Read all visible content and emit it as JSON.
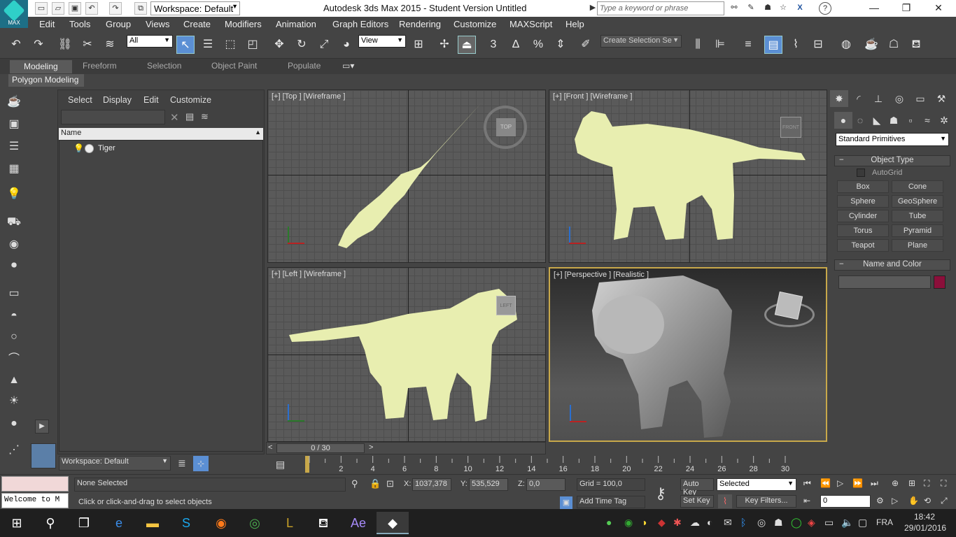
{
  "app": {
    "title": "Autodesk 3ds Max  2015  - Student Version   Untitled",
    "logo_text": "MAX",
    "workspace_dropdown": "Workspace: Default",
    "search_placeholder": "Type a keyword or phrase"
  },
  "menubar": [
    "Edit",
    "Tools",
    "Group",
    "Views",
    "Create",
    "Modifiers",
    "Animation",
    "Graph Editors",
    "Rendering",
    "Customize",
    "MAXScript",
    "Help"
  ],
  "toolbar": {
    "selection_filter": "All",
    "ref_coord": "View",
    "named_selection_placeholder": "Create Selection Se",
    "snap_label": "3",
    "angle_snap_label": "∆",
    "percent_snap_label": "%"
  },
  "ribbon": {
    "tabs": [
      "Modeling",
      "Freeform",
      "Selection",
      "Object Paint",
      "Populate"
    ],
    "panel": "Polygon Modeling"
  },
  "scene_explorer": {
    "menu": [
      "Select",
      "Display",
      "Edit",
      "Customize"
    ],
    "column_header": "Name",
    "items": [
      {
        "name": "Tiger"
      }
    ],
    "workspace": "Workspace: Default"
  },
  "viewports": {
    "top": "[+] [Top ] [Wireframe ]",
    "front": "[+] [Front ] [Wireframe ]",
    "left": "[+] [Left ] [Wireframe ]",
    "perspective": "[+] [Perspective ] [Realistic ]",
    "viewcube_top": "TOP",
    "viewcube_front": "FRONT",
    "viewcube_left": "LEFT"
  },
  "command_panel": {
    "category": "Standard Primitives",
    "object_type_title": "Object Type",
    "autogrid": "AutoGrid",
    "buttons": [
      "Box",
      "Cone",
      "Sphere",
      "GeoSphere",
      "Cylinder",
      "Tube",
      "Torus",
      "Pyramid",
      "Teapot",
      "Plane"
    ],
    "name_color_title": "Name and Color",
    "color": "#8b0f3a"
  },
  "timeline": {
    "frame": "0 / 30",
    "ticks": [
      "0",
      "2",
      "4",
      "6",
      "8",
      "10",
      "12",
      "14",
      "16",
      "18",
      "20",
      "22",
      "24",
      "26",
      "28",
      "30"
    ]
  },
  "status": {
    "selection": "None Selected",
    "prompt": "Click or click-and-drag to select objects",
    "maxscript": "Welcome to M",
    "x_label": "X:",
    "x": "1037,378",
    "y_label": "Y:",
    "y": "535,529",
    "z_label": "Z:",
    "z": "0,0",
    "grid": "Grid = 100,0",
    "add_time_tag": "Add Time Tag",
    "auto_key": "Auto Key",
    "set_key": "Set Key",
    "key_mode": "Selected",
    "key_filters": "Key Filters...",
    "current_frame": "0"
  },
  "taskbar": {
    "lang": "FRA",
    "time": "18:42",
    "date": "29/01/2016"
  },
  "colors": {
    "wire": "#e8eeb0",
    "accent": "#5b8fd4"
  }
}
